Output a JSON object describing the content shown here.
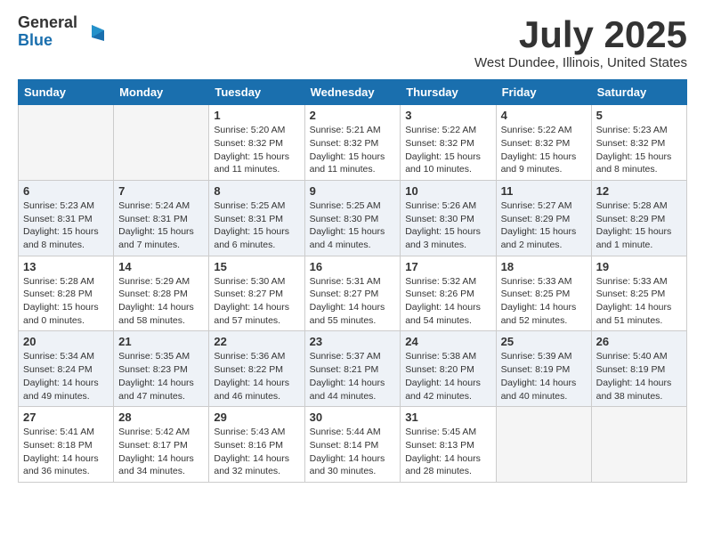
{
  "header": {
    "logo_general": "General",
    "logo_blue": "Blue",
    "month_title": "July 2025",
    "location": "West Dundee, Illinois, United States"
  },
  "calendar": {
    "days_of_week": [
      "Sunday",
      "Monday",
      "Tuesday",
      "Wednesday",
      "Thursday",
      "Friday",
      "Saturday"
    ],
    "weeks": [
      [
        {
          "day": "",
          "sunrise": "",
          "sunset": "",
          "daylight": "",
          "empty": true
        },
        {
          "day": "",
          "sunrise": "",
          "sunset": "",
          "daylight": "",
          "empty": true
        },
        {
          "day": "1",
          "sunrise": "Sunrise: 5:20 AM",
          "sunset": "Sunset: 8:32 PM",
          "daylight": "Daylight: 15 hours and 11 minutes."
        },
        {
          "day": "2",
          "sunrise": "Sunrise: 5:21 AM",
          "sunset": "Sunset: 8:32 PM",
          "daylight": "Daylight: 15 hours and 11 minutes."
        },
        {
          "day": "3",
          "sunrise": "Sunrise: 5:22 AM",
          "sunset": "Sunset: 8:32 PM",
          "daylight": "Daylight: 15 hours and 10 minutes."
        },
        {
          "day": "4",
          "sunrise": "Sunrise: 5:22 AM",
          "sunset": "Sunset: 8:32 PM",
          "daylight": "Daylight: 15 hours and 9 minutes."
        },
        {
          "day": "5",
          "sunrise": "Sunrise: 5:23 AM",
          "sunset": "Sunset: 8:32 PM",
          "daylight": "Daylight: 15 hours and 8 minutes."
        }
      ],
      [
        {
          "day": "6",
          "sunrise": "Sunrise: 5:23 AM",
          "sunset": "Sunset: 8:31 PM",
          "daylight": "Daylight: 15 hours and 8 minutes."
        },
        {
          "day": "7",
          "sunrise": "Sunrise: 5:24 AM",
          "sunset": "Sunset: 8:31 PM",
          "daylight": "Daylight: 15 hours and 7 minutes."
        },
        {
          "day": "8",
          "sunrise": "Sunrise: 5:25 AM",
          "sunset": "Sunset: 8:31 PM",
          "daylight": "Daylight: 15 hours and 6 minutes."
        },
        {
          "day": "9",
          "sunrise": "Sunrise: 5:25 AM",
          "sunset": "Sunset: 8:30 PM",
          "daylight": "Daylight: 15 hours and 4 minutes."
        },
        {
          "day": "10",
          "sunrise": "Sunrise: 5:26 AM",
          "sunset": "Sunset: 8:30 PM",
          "daylight": "Daylight: 15 hours and 3 minutes."
        },
        {
          "day": "11",
          "sunrise": "Sunrise: 5:27 AM",
          "sunset": "Sunset: 8:29 PM",
          "daylight": "Daylight: 15 hours and 2 minutes."
        },
        {
          "day": "12",
          "sunrise": "Sunrise: 5:28 AM",
          "sunset": "Sunset: 8:29 PM",
          "daylight": "Daylight: 15 hours and 1 minute."
        }
      ],
      [
        {
          "day": "13",
          "sunrise": "Sunrise: 5:28 AM",
          "sunset": "Sunset: 8:28 PM",
          "daylight": "Daylight: 15 hours and 0 minutes."
        },
        {
          "day": "14",
          "sunrise": "Sunrise: 5:29 AM",
          "sunset": "Sunset: 8:28 PM",
          "daylight": "Daylight: 14 hours and 58 minutes."
        },
        {
          "day": "15",
          "sunrise": "Sunrise: 5:30 AM",
          "sunset": "Sunset: 8:27 PM",
          "daylight": "Daylight: 14 hours and 57 minutes."
        },
        {
          "day": "16",
          "sunrise": "Sunrise: 5:31 AM",
          "sunset": "Sunset: 8:27 PM",
          "daylight": "Daylight: 14 hours and 55 minutes."
        },
        {
          "day": "17",
          "sunrise": "Sunrise: 5:32 AM",
          "sunset": "Sunset: 8:26 PM",
          "daylight": "Daylight: 14 hours and 54 minutes."
        },
        {
          "day": "18",
          "sunrise": "Sunrise: 5:33 AM",
          "sunset": "Sunset: 8:25 PM",
          "daylight": "Daylight: 14 hours and 52 minutes."
        },
        {
          "day": "19",
          "sunrise": "Sunrise: 5:33 AM",
          "sunset": "Sunset: 8:25 PM",
          "daylight": "Daylight: 14 hours and 51 minutes."
        }
      ],
      [
        {
          "day": "20",
          "sunrise": "Sunrise: 5:34 AM",
          "sunset": "Sunset: 8:24 PM",
          "daylight": "Daylight: 14 hours and 49 minutes."
        },
        {
          "day": "21",
          "sunrise": "Sunrise: 5:35 AM",
          "sunset": "Sunset: 8:23 PM",
          "daylight": "Daylight: 14 hours and 47 minutes."
        },
        {
          "day": "22",
          "sunrise": "Sunrise: 5:36 AM",
          "sunset": "Sunset: 8:22 PM",
          "daylight": "Daylight: 14 hours and 46 minutes."
        },
        {
          "day": "23",
          "sunrise": "Sunrise: 5:37 AM",
          "sunset": "Sunset: 8:21 PM",
          "daylight": "Daylight: 14 hours and 44 minutes."
        },
        {
          "day": "24",
          "sunrise": "Sunrise: 5:38 AM",
          "sunset": "Sunset: 8:20 PM",
          "daylight": "Daylight: 14 hours and 42 minutes."
        },
        {
          "day": "25",
          "sunrise": "Sunrise: 5:39 AM",
          "sunset": "Sunset: 8:19 PM",
          "daylight": "Daylight: 14 hours and 40 minutes."
        },
        {
          "day": "26",
          "sunrise": "Sunrise: 5:40 AM",
          "sunset": "Sunset: 8:19 PM",
          "daylight": "Daylight: 14 hours and 38 minutes."
        }
      ],
      [
        {
          "day": "27",
          "sunrise": "Sunrise: 5:41 AM",
          "sunset": "Sunset: 8:18 PM",
          "daylight": "Daylight: 14 hours and 36 minutes."
        },
        {
          "day": "28",
          "sunrise": "Sunrise: 5:42 AM",
          "sunset": "Sunset: 8:17 PM",
          "daylight": "Daylight: 14 hours and 34 minutes."
        },
        {
          "day": "29",
          "sunrise": "Sunrise: 5:43 AM",
          "sunset": "Sunset: 8:16 PM",
          "daylight": "Daylight: 14 hours and 32 minutes."
        },
        {
          "day": "30",
          "sunrise": "Sunrise: 5:44 AM",
          "sunset": "Sunset: 8:14 PM",
          "daylight": "Daylight: 14 hours and 30 minutes."
        },
        {
          "day": "31",
          "sunrise": "Sunrise: 5:45 AM",
          "sunset": "Sunset: 8:13 PM",
          "daylight": "Daylight: 14 hours and 28 minutes."
        },
        {
          "day": "",
          "sunrise": "",
          "sunset": "",
          "daylight": "",
          "empty": true
        },
        {
          "day": "",
          "sunrise": "",
          "sunset": "",
          "daylight": "",
          "empty": true
        }
      ]
    ]
  }
}
